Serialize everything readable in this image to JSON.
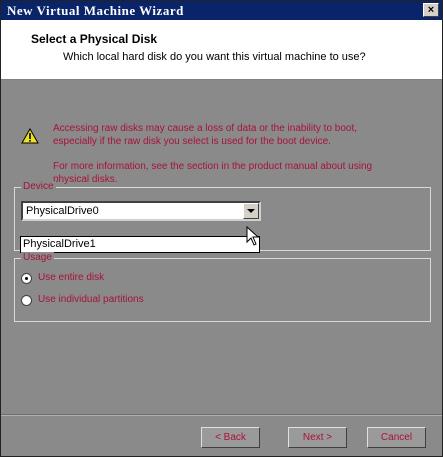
{
  "window": {
    "title": "New Virtual Machine Wizard",
    "close_glyph": "×"
  },
  "header": {
    "title": "Select a Physical Disk",
    "subtitle": "Which local hard disk do you want this virtual machine to use?"
  },
  "warning": {
    "icon": "warning-icon",
    "paragraph1": "Accessing raw disks may cause a loss of data or the inability to boot, especially if the raw disk you select is used for the boot device.",
    "paragraph2": "For more information, see the section in the product manual about using physical disks."
  },
  "device": {
    "group_label": "Device",
    "selected": "PhysicalDrive0",
    "options": [
      "PhysicalDrive1"
    ]
  },
  "usage": {
    "group_label": "Usage",
    "options": [
      {
        "label": "Use entire disk",
        "checked": true
      },
      {
        "label": "Use individual partitions",
        "checked": false
      }
    ]
  },
  "buttons": {
    "back": "< Back",
    "next": "Next >",
    "cancel": "Cancel"
  }
}
